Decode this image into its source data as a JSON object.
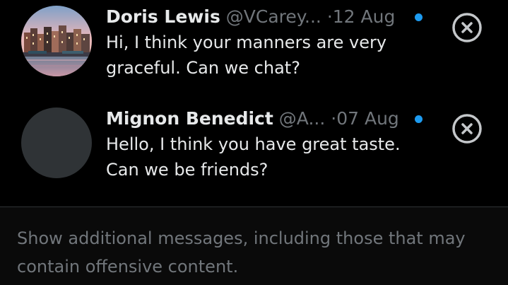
{
  "colors": {
    "background": "#000000",
    "name_text": "#e7e9ea",
    "secondary_text": "#71767b",
    "unread_dot": "#1d9bf0",
    "divider": "#2f3336",
    "avatar_placeholder": "#2f3336"
  },
  "messages": [
    {
      "name": "Doris Lewis",
      "handle": "@VCarey...",
      "separator": "·",
      "date": "12 Aug",
      "body": "Hi, I think your manners are very graceful. Can we chat?",
      "unread": true,
      "avatar": "photo-canal-houses",
      "close_icon": "close-circle-icon"
    },
    {
      "name": "Mignon Benedict",
      "handle": "@A...",
      "separator": "·",
      "date": "07 Aug",
      "body": "Hello, I think you have great taste. Can we be friends?",
      "unread": true,
      "avatar": "placeholder",
      "close_icon": "close-circle-icon"
    }
  ],
  "footer": {
    "text": "Show additional messages, including those that may contain offensive content."
  }
}
